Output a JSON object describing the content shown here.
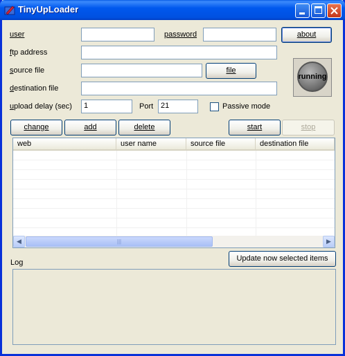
{
  "window": {
    "title": "TinyUpLoader"
  },
  "form": {
    "user_label": "user",
    "user_value": "",
    "password_label": "password",
    "password_value": "",
    "ftp_label": "ftp address",
    "ftp_value": "",
    "source_label": "source file",
    "source_value": "",
    "destination_label": "destination file",
    "destination_value": "",
    "delay_label": "upload delay (sec)",
    "delay_value": "1",
    "port_label": "Port",
    "port_value": "21",
    "passive_label": "Passive mode",
    "passive_checked": false
  },
  "buttons": {
    "about": "about",
    "file": "file",
    "change": "change",
    "add": "add",
    "delete": "delete",
    "start": "start",
    "stop": "stop",
    "update": "Update now selected items"
  },
  "status": {
    "running": "running"
  },
  "table": {
    "columns": [
      "web",
      "user name",
      "source file",
      "destination file"
    ],
    "rows": []
  },
  "log": {
    "label": "Log",
    "content": ""
  },
  "colors": {
    "title_bar": "#0058ee",
    "window_bg": "#ece9d8",
    "border": "#7f9db9"
  }
}
